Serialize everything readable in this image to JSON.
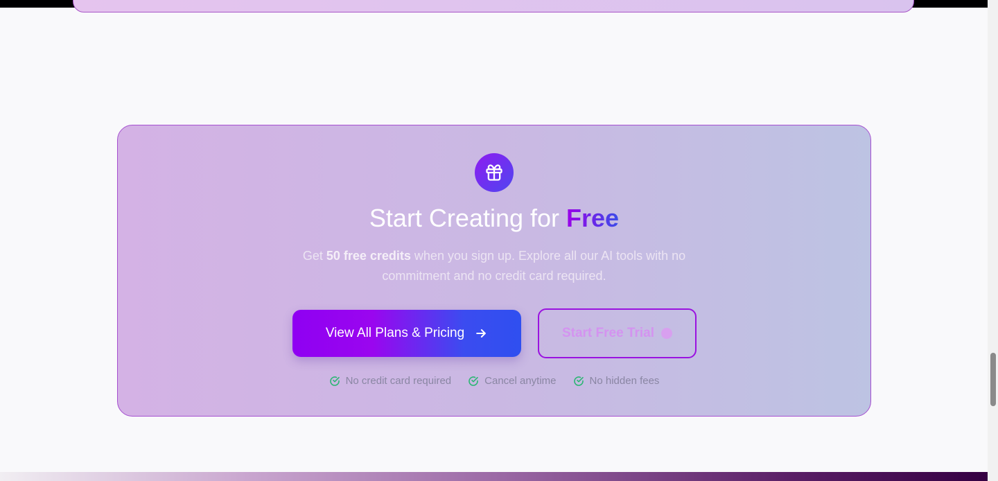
{
  "cta": {
    "headline_prefix": "Start Creating for ",
    "headline_accent": "Free",
    "subtext_before": "Get ",
    "subtext_bold": "50 free credits",
    "subtext_after": " when you sign up. Explore all our AI tools with no commitment and no credit card required.",
    "primary_button": "View All Plans & Pricing",
    "secondary_button": "Start Free Trial",
    "features": [
      "No credit card required",
      "Cancel anytime",
      "No hidden fees"
    ]
  },
  "icons": {
    "badge": "gift-icon",
    "primary_button": "arrow-right-icon",
    "secondary_button": "sparkle-icon",
    "feature": "check-circle-icon"
  },
  "colors": {
    "accent_purple": "#9b00e8",
    "accent_blue": "#3a4de9",
    "card_border": "#a54fd0",
    "check_green": "#2bb673",
    "feature_text": "#8a86a3"
  }
}
